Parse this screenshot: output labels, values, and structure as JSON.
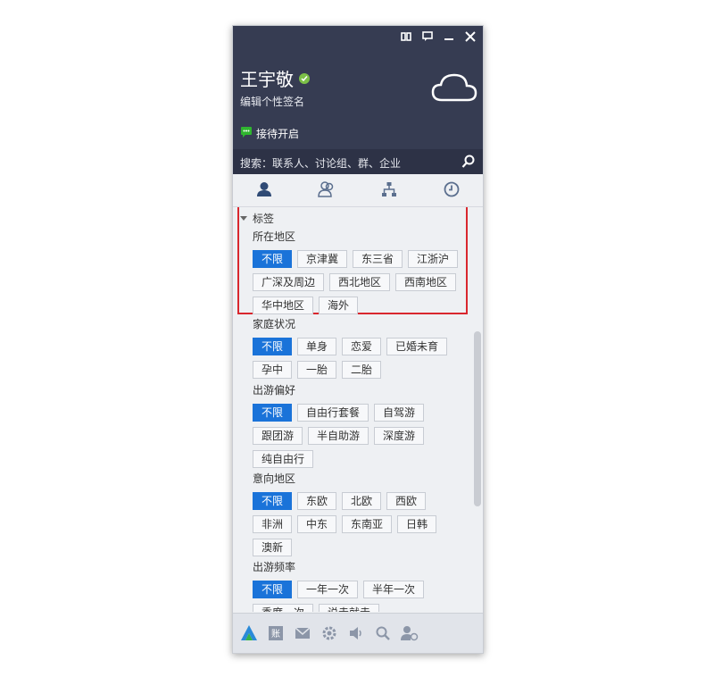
{
  "profile": {
    "name": "王宇敬",
    "signature": "编辑个性签名",
    "reception": "接待开启"
  },
  "search": {
    "placeholder": "搜索：联系人、讨论组、群、企业"
  },
  "tabs": [
    {
      "icon": "person-icon"
    },
    {
      "icon": "contacts-icon"
    },
    {
      "icon": "org-chart-icon"
    },
    {
      "icon": "clock-icon"
    }
  ],
  "tags": {
    "title": "标签",
    "groups": [
      {
        "title": "所在地区",
        "options": [
          "不限",
          "京津冀",
          "东三省",
          "江浙沪",
          "广深及周边",
          "西北地区",
          "西南地区",
          "华中地区",
          "海外"
        ],
        "selected": "不限"
      },
      {
        "title": "家庭状况",
        "options": [
          "不限",
          "单身",
          "恋爱",
          "已婚未育",
          "孕中",
          "一胎",
          "二胎"
        ],
        "selected": "不限"
      },
      {
        "title": "出游偏好",
        "options": [
          "不限",
          "自由行套餐",
          "自驾游",
          "跟团游",
          "半自助游",
          "深度游",
          "纯自由行"
        ],
        "selected": "不限"
      },
      {
        "title": "意向地区",
        "options": [
          "不限",
          "东欧",
          "北欧",
          "西欧",
          "非洲",
          "中东",
          "东南亚",
          "日韩",
          "澳新"
        ],
        "selected": "不限"
      },
      {
        "title": "出游频率",
        "options": [
          "不限",
          "一年一次",
          "半年一次",
          "季度一次",
          "说走就走"
        ],
        "selected": "不限"
      }
    ]
  },
  "colors": {
    "header": "#363c52",
    "accent": "#1a73d9",
    "highlight": "#d9272e"
  },
  "footer_icons": [
    "app-logo-icon",
    "account-icon",
    "mail-icon",
    "settings-icon",
    "speaker-icon",
    "search-icon",
    "user-settings-icon"
  ]
}
